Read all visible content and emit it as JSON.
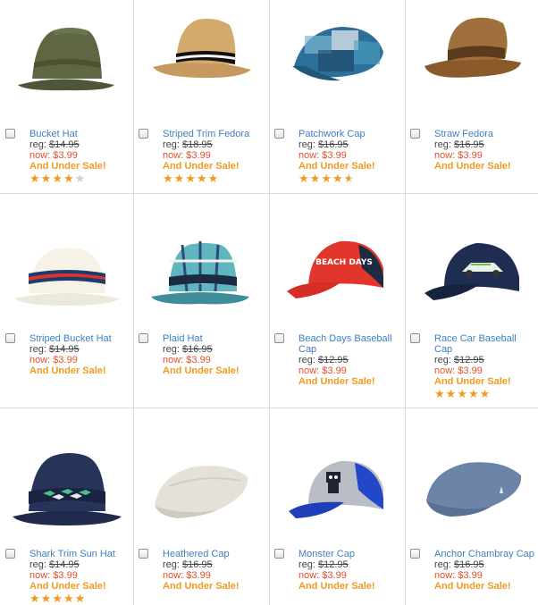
{
  "products": [
    {
      "name": "Bucket Hat",
      "reg_label": "reg: ",
      "reg_price": "$14.95",
      "now": "now: $3.99",
      "sale": "And Under Sale!",
      "rating": 4,
      "image": "bucket-hat-olive"
    },
    {
      "name": "Striped Trim Fedora",
      "reg_label": "reg: ",
      "reg_price": "$18.95",
      "now": "now: $3.99",
      "sale": "And Under Sale!",
      "rating": 5,
      "image": "fedora-straw-striped"
    },
    {
      "name": "Patchwork Cap",
      "reg_label": "reg: ",
      "reg_price": "$16.95",
      "now": "now: $3.99",
      "sale": "And Under Sale!",
      "rating": 4.5,
      "image": "patchwork-cap"
    },
    {
      "name": "Straw Fedora",
      "reg_label": "reg: ",
      "reg_price": "$16.95",
      "now": "now: $3.99",
      "sale": "And Under Sale!",
      "rating": null,
      "image": "straw-fedora-brown"
    },
    {
      "name": "Striped Bucket Hat",
      "reg_label": "reg: ",
      "reg_price": "$14.95",
      "now": "now: $3.99",
      "sale": "And Under Sale!",
      "rating": null,
      "image": "bucket-hat-white-striped"
    },
    {
      "name": "Plaid Hat",
      "reg_label": "reg: ",
      "reg_price": "$16.95",
      "now": "now: $3.99",
      "sale": "And Under Sale!",
      "rating": null,
      "image": "plaid-bucket-hat"
    },
    {
      "name": "Beach Days Baseball Cap",
      "reg_label": "reg: ",
      "reg_price": "$12.95",
      "now": "now: $3.99",
      "sale": "And Under Sale!",
      "rating": null,
      "image": "red-baseball-cap",
      "cap_text": "BEACH DAYS"
    },
    {
      "name": "Race Car Baseball Cap",
      "reg_label": "reg: ",
      "reg_price": "$12.95",
      "now": "now: $3.99",
      "sale": "And Under Sale!",
      "rating": 5,
      "image": "navy-race-car-cap"
    },
    {
      "name": "Shark Trim Sun Hat",
      "reg_label": "reg: ",
      "reg_price": "$14.95",
      "now": "now: $3.99",
      "sale": "And Under Sale!",
      "rating": 5,
      "image": "navy-shark-bucket-hat"
    },
    {
      "name": "Heathered Cap",
      "reg_label": "reg: ",
      "reg_price": "$16.95",
      "now": "now: $3.99",
      "sale": "And Under Sale!",
      "rating": null,
      "image": "heathered-flat-cap"
    },
    {
      "name": "Monster Cap",
      "reg_label": "reg: ",
      "reg_price": "$12.95",
      "now": "now: $3.99",
      "sale": "And Under Sale!",
      "rating": null,
      "image": "monster-baseball-cap"
    },
    {
      "name": "Anchor Chambray Cap",
      "reg_label": "reg: ",
      "reg_price": "$16.95",
      "now": "now: $3.99",
      "sale": "And Under Sale!",
      "rating": null,
      "image": "chambray-flat-cap"
    }
  ]
}
